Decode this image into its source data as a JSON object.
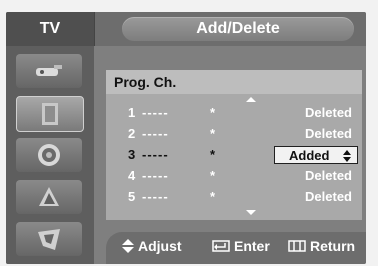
{
  "header": {
    "source": "TV",
    "title": "Add/Delete"
  },
  "sidebar": {
    "items": [
      {
        "icon": "antenna-icon"
      },
      {
        "icon": "picture-icon"
      },
      {
        "icon": "sound-icon"
      },
      {
        "icon": "channel-icon"
      },
      {
        "icon": "setup-icon"
      }
    ]
  },
  "list": {
    "heading": "Prog. Ch.",
    "rows": [
      {
        "number": "1",
        "name": "-----",
        "mark": "*",
        "status": "Deleted"
      },
      {
        "number": "2",
        "name": "-----",
        "mark": "*",
        "status": "Deleted"
      },
      {
        "number": "3",
        "name": "-----",
        "mark": "*",
        "status": "Added"
      },
      {
        "number": "4",
        "name": "-----",
        "mark": "*",
        "status": "Deleted"
      },
      {
        "number": "5",
        "name": "-----",
        "mark": "*",
        "status": "Deleted"
      }
    ]
  },
  "footer": {
    "adjust": "Adjust",
    "enter": "Enter",
    "return": "Return"
  },
  "colors": {
    "panel": "#7f7f7f",
    "selected_box": "#f2f2f2",
    "text": "#ffffff"
  }
}
